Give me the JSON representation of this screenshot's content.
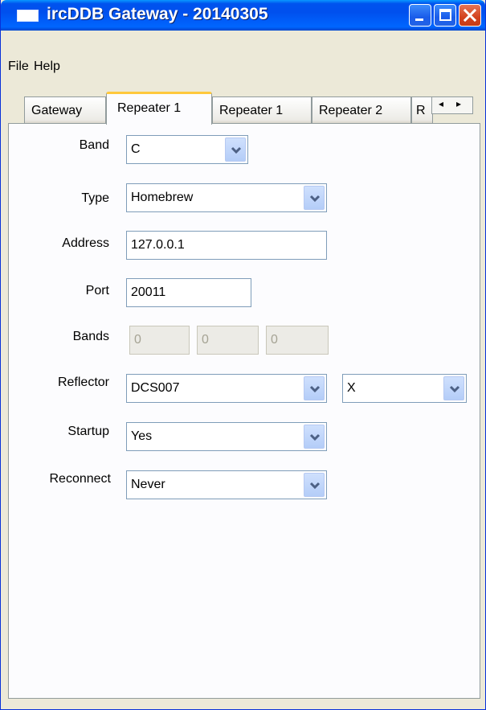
{
  "window": {
    "title": "ircDDB Gateway - 20140305"
  },
  "menu": {
    "file": "File",
    "help": "Help"
  },
  "tabs": [
    {
      "label": "Gateway"
    },
    {
      "label": "Repeater 1"
    },
    {
      "label": "Repeater 1"
    },
    {
      "label": "Repeater 2"
    },
    {
      "label": "R"
    }
  ],
  "tab_scroll": {
    "left": "◂",
    "right": "▸"
  },
  "form": {
    "band": {
      "label": "Band",
      "value": "C"
    },
    "type": {
      "label": "Type",
      "value": "Homebrew"
    },
    "address": {
      "label": "Address",
      "value": "127.0.0.1"
    },
    "port": {
      "label": "Port",
      "value": "20011"
    },
    "bands": {
      "label": "Bands",
      "values": [
        "0",
        "0",
        "0"
      ]
    },
    "reflector": {
      "label": "Reflector",
      "value": "DCS007",
      "module": "X"
    },
    "startup": {
      "label": "Startup",
      "value": "Yes"
    },
    "reconnect": {
      "label": "Reconnect",
      "value": "Never"
    }
  },
  "colors": {
    "titlebar": "#0053ee",
    "active_tab_accent": "#ffc83c",
    "close_button": "#d3421e"
  }
}
